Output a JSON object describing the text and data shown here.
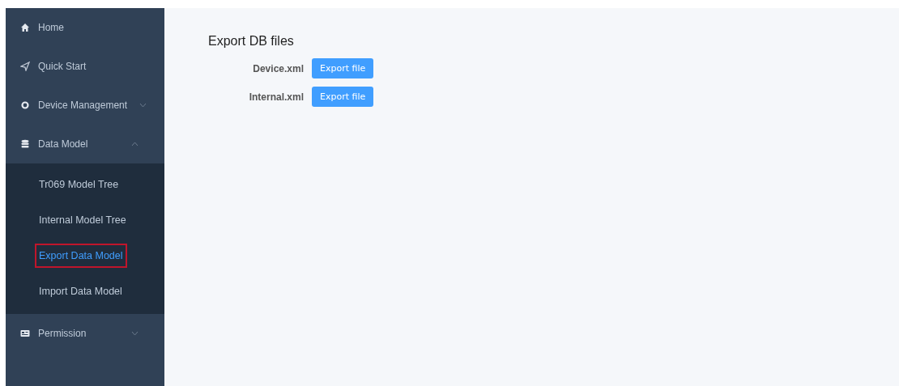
{
  "sidebar": {
    "items": [
      {
        "label": "Home",
        "kind": "link"
      },
      {
        "label": "Quick Start",
        "kind": "link"
      },
      {
        "label": "Device Management",
        "kind": "group",
        "expanded": false
      },
      {
        "label": "Data Model",
        "kind": "group",
        "expanded": true,
        "children": [
          {
            "label": "Tr069 Model Tree",
            "selected": false
          },
          {
            "label": "Internal Model Tree",
            "selected": false
          },
          {
            "label": "Export Data Model",
            "selected": true
          },
          {
            "label": "Import Data Model",
            "selected": false
          }
        ]
      },
      {
        "label": "Permission",
        "kind": "group",
        "expanded": false
      }
    ]
  },
  "main": {
    "title": "Export DB files",
    "rows": [
      {
        "label": "Device.xml",
        "button": "Export file"
      },
      {
        "label": "Internal.xml",
        "button": "Export file"
      }
    ]
  }
}
